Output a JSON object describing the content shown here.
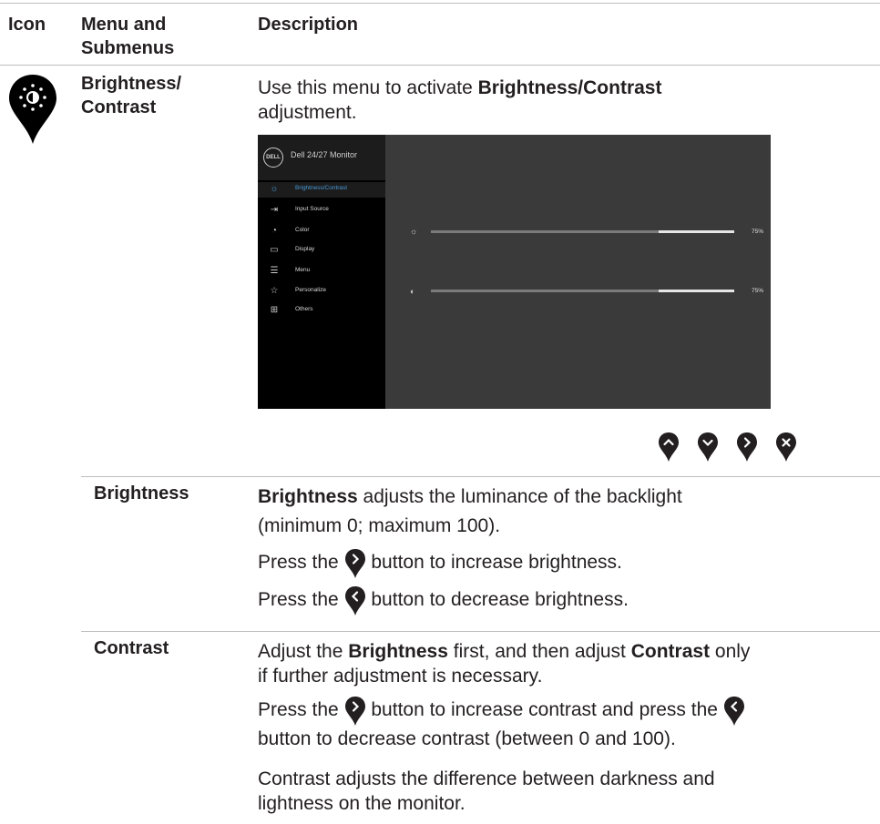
{
  "table": {
    "headers": {
      "icon": "Icon",
      "menu_line1": "Menu and",
      "menu_line2": "Submenus",
      "description": "Description"
    }
  },
  "row_main": {
    "menu_line1": "Brightness/",
    "menu_line2": "Contrast",
    "desc_pre": "Use this menu to activate ",
    "desc_bold": "Brightness/Contrast",
    "desc_line2": "adjustment."
  },
  "osd": {
    "logo": "DELL",
    "title": "Dell 24/27 Monitor",
    "menu_items": [
      {
        "label": "Brightness/Contrast",
        "icon": "sun-icon",
        "selected": true
      },
      {
        "label": "Input Source",
        "icon": "input-icon",
        "selected": false
      },
      {
        "label": "Color",
        "icon": "color-icon",
        "selected": false
      },
      {
        "label": "Display",
        "icon": "display-icon",
        "selected": false
      },
      {
        "label": "Menu",
        "icon": "menu-icon",
        "selected": false
      },
      {
        "label": "Personalize",
        "icon": "star-icon",
        "selected": false
      },
      {
        "label": "Others",
        "icon": "others-icon",
        "selected": false
      }
    ],
    "sliders": [
      {
        "name": "brightness",
        "value": 75,
        "label": "75%"
      },
      {
        "name": "contrast",
        "value": 75,
        "label": "75%"
      }
    ],
    "nav_buttons": [
      "up-button-icon",
      "down-button-icon",
      "right-button-icon",
      "close-button-icon"
    ]
  },
  "row_brightness": {
    "name": "Brightness",
    "p1_bold": "Brightness",
    "p1_rest": " adjusts the luminance of the backlight",
    "p1_line2": "(minimum 0; maximum 100).",
    "p2_pre": "Press the ",
    "p2_post": " button to increase brightness.",
    "p3_pre": "Press the ",
    "p3_post": " button to decrease brightness."
  },
  "row_contrast": {
    "name": "Contrast",
    "p1_pre": "Adjust the ",
    "p1_bold1": "Brightness",
    "p1_mid": " first, and then adjust ",
    "p1_bold2": "Contrast",
    "p1_post": " only",
    "p1_line2": "if further adjustment is necessary.",
    "p2_pre": "Press the ",
    "p2_post": "  button to increase contrast and press the",
    "p2_line2": "button to decrease contrast (between 0 and 100).",
    "p3_line1": "Contrast adjusts the difference between darkness and",
    "p3_line2": "lightness on the monitor."
  },
  "colors": {
    "text": "#231f20",
    "rule": "#bdbdbd",
    "osd_bg": "#3a3a3a",
    "osd_accent": "#4a9ad8"
  }
}
